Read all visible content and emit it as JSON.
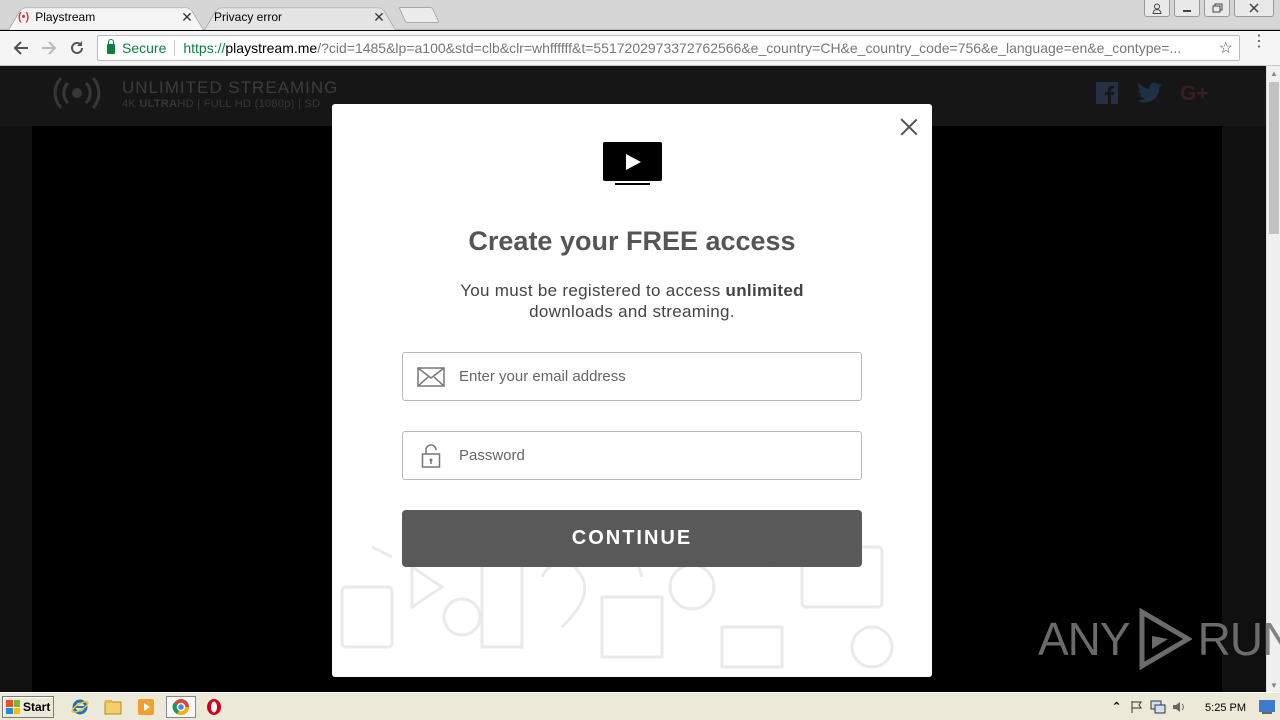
{
  "browser": {
    "tabs": [
      {
        "label": "Playstream",
        "active": true
      },
      {
        "label": "Privacy error",
        "active": false
      }
    ],
    "security_label": "Secure",
    "url": {
      "protocol": "https://",
      "host": "playstream.me",
      "rest": "/?cid=1485&lp=a100&std=clb&clr=whffffff&t=5517202973372762566&e_country=CH&e_country_code=756&e_language=en&e_contype=..."
    }
  },
  "site": {
    "title": "UNLIMITED STREAMING",
    "subtitle_bold_prefix": "4K ",
    "subtitle_bold": "ULTRA",
    "subtitle_rest": "HD | FULL HD (1080p) | SD"
  },
  "modal": {
    "title": "Create your FREE access",
    "desc_pre": "You must be registered to access ",
    "desc_bold": "unlimited",
    "desc_post": "downloads and streaming.",
    "email_placeholder": "Enter your email address",
    "password_placeholder": "Password",
    "continue_label": "CONTINUE"
  },
  "watermark": {
    "left": "ANY",
    "right": "RUN"
  },
  "taskbar": {
    "start_label": "Start",
    "clock": "5:25 PM"
  },
  "colors": {
    "secure_green": "#0b8043",
    "button_gray": "#595959",
    "title_gray": "#555555"
  }
}
